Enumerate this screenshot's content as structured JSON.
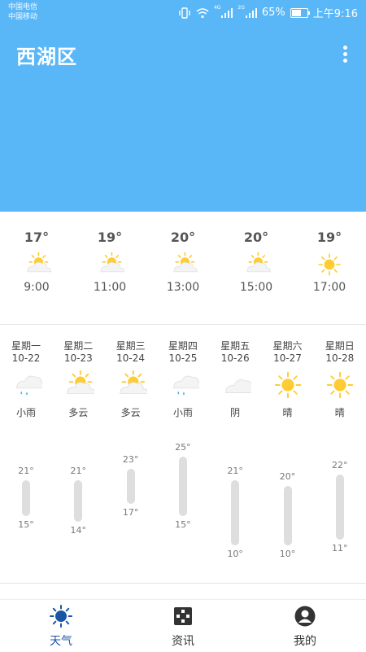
{
  "status_bar": {
    "carrier1": "中国电信",
    "carrier2": "中国移动",
    "net1": "4G",
    "net2": "2G",
    "battery": "65%",
    "battery_level": 0.65,
    "time": "上午9:16"
  },
  "header": {
    "location": "西湖区",
    "bg_color": "#59b7f7"
  },
  "hourly": [
    {
      "temp": "17°",
      "time": "9:00",
      "icon": "partly-cloudy-icon"
    },
    {
      "temp": "19°",
      "time": "11:00",
      "icon": "partly-cloudy-icon"
    },
    {
      "temp": "20°",
      "time": "13:00",
      "icon": "partly-cloudy-icon"
    },
    {
      "temp": "20°",
      "time": "15:00",
      "icon": "partly-cloudy-icon"
    },
    {
      "temp": "19°",
      "time": "17:00",
      "icon": "sun-icon"
    }
  ],
  "daily": [
    {
      "weekday": "星期一",
      "date": "10-22",
      "condition": "小雨",
      "icon": "light-rain-icon",
      "high": "21°",
      "low": "15°",
      "high_val": 21,
      "low_val": 15
    },
    {
      "weekday": "星期二",
      "date": "10-23",
      "condition": "多云",
      "icon": "partly-cloudy-icon",
      "high": "21°",
      "low": "14°",
      "high_val": 21,
      "low_val": 14
    },
    {
      "weekday": "星期三",
      "date": "10-24",
      "condition": "多云",
      "icon": "partly-cloudy-icon",
      "high": "23°",
      "low": "17°",
      "high_val": 23,
      "low_val": 17
    },
    {
      "weekday": "星期四",
      "date": "10-25",
      "condition": "小雨",
      "icon": "light-rain-icon",
      "high": "25°",
      "low": "15°",
      "high_val": 25,
      "low_val": 15
    },
    {
      "weekday": "星期五",
      "date": "10-26",
      "condition": "阴",
      "icon": "overcast-icon",
      "high": "21°",
      "low": "10°",
      "high_val": 21,
      "low_val": 10
    },
    {
      "weekday": "星期六",
      "date": "10-27",
      "condition": "晴",
      "icon": "sun-icon",
      "high": "20°",
      "low": "10°",
      "high_val": 20,
      "low_val": 10
    },
    {
      "weekday": "星期日",
      "date": "10-28",
      "condition": "晴",
      "icon": "sun-icon",
      "high": "22°",
      "low": "11°",
      "high_val": 22,
      "low_val": 11
    }
  ],
  "nav": [
    {
      "label": "天气",
      "icon": "weather-sun-icon",
      "active": true
    },
    {
      "label": "资讯",
      "icon": "news-icon",
      "active": false
    },
    {
      "label": "我的",
      "icon": "profile-icon",
      "active": false
    }
  ],
  "colors": {
    "accent": "#1a55a3",
    "sun": "#ffcc33",
    "rain": "#5ab0e8",
    "bar": "#dedede"
  }
}
